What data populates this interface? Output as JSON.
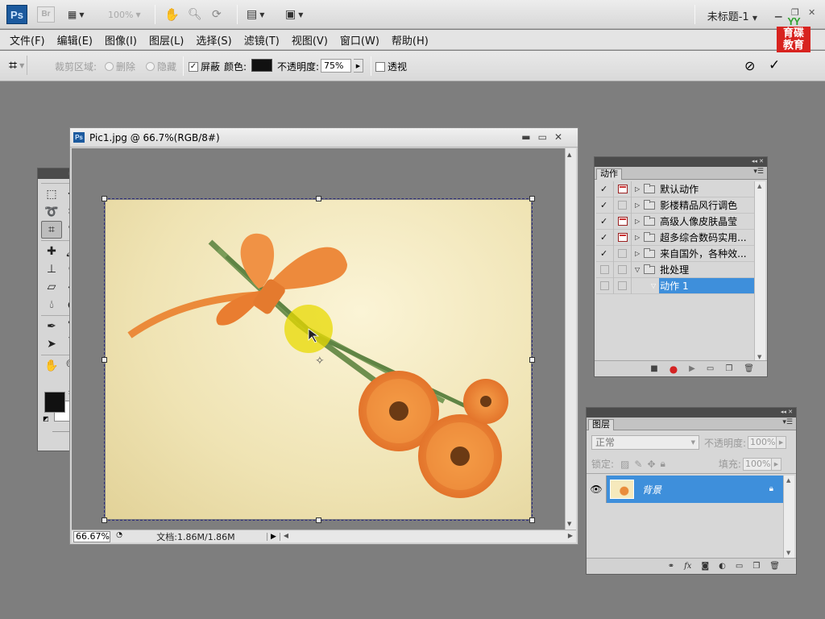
{
  "app": {
    "logo": "Ps",
    "bridge": "Br",
    "zoom": "100%",
    "doc_title": "未标题-1",
    "brand_top": "YY",
    "brand_line1": "育碟",
    "brand_line2": "教育"
  },
  "menu": [
    "文件(F)",
    "编辑(E)",
    "图像(I)",
    "图层(L)",
    "选择(S)",
    "滤镜(T)",
    "视图(V)",
    "窗口(W)",
    "帮助(H)"
  ],
  "options": {
    "crop_area_label": "裁剪区域:",
    "delete_label": "删除",
    "hide_label": "隐藏",
    "shield_label": "屏蔽",
    "shield_checked": true,
    "color_label": "颜色:",
    "shield_color": "#111111",
    "opacity_label": "不透明度:",
    "opacity_value": "75%",
    "perspective_label": "透视",
    "perspective_checked": false
  },
  "document": {
    "title": "Pic1.jpg @ 66.7%(RGB/8#)",
    "zoom_value": "66.67%",
    "status_text": "文档:1.86M/1.86M"
  },
  "actions_panel": {
    "tab": "动作",
    "rows": [
      {
        "checked": true,
        "dialog": true,
        "label": "默认动作",
        "type": "set",
        "expanded": false
      },
      {
        "checked": true,
        "dialog": false,
        "label": "影楼精品风行调色",
        "type": "set",
        "expanded": false
      },
      {
        "checked": true,
        "dialog": true,
        "label": "高级人像皮肤晶莹",
        "type": "set",
        "expanded": false
      },
      {
        "checked": true,
        "dialog": true,
        "label": "超多综合数码实用...",
        "type": "set",
        "expanded": false
      },
      {
        "checked": true,
        "dialog": false,
        "label": "来自国外，各种效...",
        "type": "set",
        "expanded": false
      },
      {
        "checked": false,
        "dialog": false,
        "label": "批处理",
        "type": "set",
        "expanded": true
      },
      {
        "checked": false,
        "dialog": false,
        "label": "动作 1",
        "type": "action",
        "expanded": true,
        "selected": true
      }
    ]
  },
  "layers_panel": {
    "tab": "图层",
    "blend_mode": "正常",
    "opacity_label": "不透明度:",
    "opacity_value": "100%",
    "lock_label": "锁定:",
    "fill_label": "填充:",
    "fill_value": "100%",
    "layers": [
      {
        "name": "背景",
        "visible": true,
        "locked": true
      }
    ]
  },
  "colors": {
    "selection": "#3e8fdb",
    "workspace": "#7e7e7e",
    "foreground": "#111111",
    "background": "#ffffff"
  }
}
